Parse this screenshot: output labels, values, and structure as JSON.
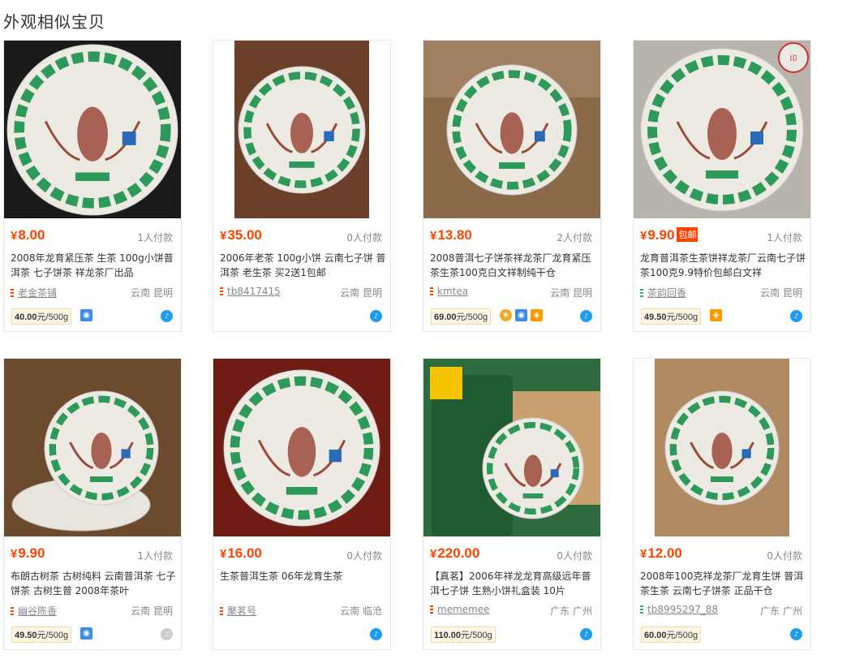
{
  "section_title": "外观相似宝贝",
  "colors": {
    "price": "#ff4400",
    "accent_blue": "#1e9cf0"
  },
  "products": [
    {
      "price": "8.00",
      "sales": "1人付款",
      "title": "2008年龙育紧压茶 生茶 100g小饼普洱茶 七子饼茶 祥龙茶厂出品",
      "shop": "老金茶铺",
      "location": "云南 昆明",
      "unit_price": "40.00",
      "unit": "元/500g",
      "badges": [
        "blue-quality-icon"
      ],
      "ww_icon": "wangwang-online-icon"
    },
    {
      "price": "35.00",
      "sales": "0人付款",
      "title": "2006年老茶 100g小饼 云南七子饼 普洱茶 老生茶 买2送1包邮",
      "shop": "tb8417415",
      "location": "云南 昆明",
      "ww_icon": "wangwang-online-icon"
    },
    {
      "price": "13.80",
      "sales": "2人付款",
      "title": "2008普洱七子饼茶祥龙茶厂龙育紧压茶生茶100克白文祥制纯干仓",
      "shop": "kmtea",
      "location": "云南 昆明",
      "unit_price": "69.00",
      "unit": "元/500g",
      "badges": [
        "gold-medal-icon",
        "blue-quality-icon",
        "orange-shield-icon"
      ],
      "ww_icon": "wangwang-online-icon"
    },
    {
      "price": "9.90",
      "promo": "包邮",
      "sales": "1人付款",
      "title": "龙育普洱茶生茶饼祥龙茶厂云南七子饼茶100克9.9特价包邮白文祥",
      "shop": "茶韵回香",
      "location": "云南 昆明",
      "unit_price": "49.50",
      "unit": "元/500g",
      "badges": [
        "orange-shield-icon"
      ],
      "ww_icon": "wangwang-online-icon"
    },
    {
      "price": "9.90",
      "sales": "1人付款",
      "title": "布朗古树茶 古树纯料 云南普洱茶 七子饼茶 古树生普 2008年茶叶",
      "shop": "幽谷陈香",
      "location": "云南 昆明",
      "unit_price": "49.50",
      "unit": "元/500g",
      "badges": [
        "blue-quality-icon"
      ],
      "ww_icon": "wangwang-offline-icon"
    },
    {
      "price": "16.00",
      "sales": "0人付款",
      "title": "生茶普洱生茶 06年龙育生茶",
      "shop": "聚茗号",
      "location": "云南 临沧",
      "ww_icon": "wangwang-online-icon"
    },
    {
      "price": "220.00",
      "sales": "0人付款",
      "title": "【真茗】2006年祥龙龙育高级远年普洱七子饼 生熟小饼礼盒装 10片",
      "shop": "mememee",
      "location": "广东 广州",
      "unit_price": "110.00",
      "unit": "元/500g",
      "ww_icon": "wangwang-online-icon"
    },
    {
      "price": "12.00",
      "sales": "0人付款",
      "title": "2008年100克祥龙茶厂龙育生饼 普洱茶生茶 云南七子饼茶 正品干仓",
      "shop": "tb8995297_88",
      "location": "广东 广州",
      "unit_price": "60.00",
      "unit": "元/500g",
      "ww_icon": "wangwang-online-icon"
    }
  ]
}
